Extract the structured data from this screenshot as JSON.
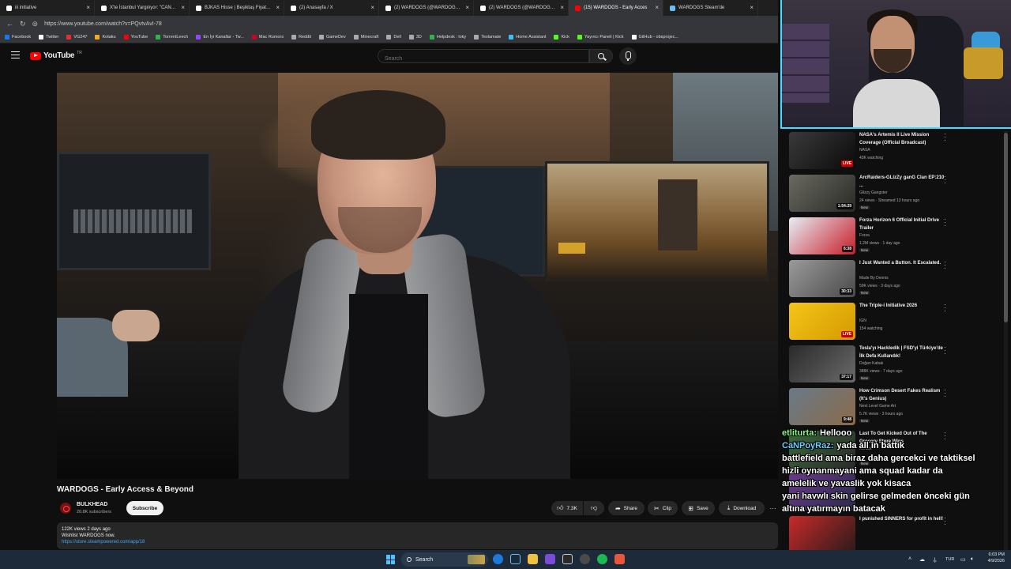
{
  "browser": {
    "tabs": [
      {
        "label": "iii initiative",
        "icon_color": "#ffffff",
        "active": false
      },
      {
        "label": "X'te İstanbul Yargılıyor: \"CANLI BL",
        "icon_color": "#ffffff",
        "active": false
      },
      {
        "label": "BJKAS Hisse | Beşiktaş Fiyatları - İn",
        "icon_color": "#ffffff",
        "active": false
      },
      {
        "label": "(2) Anasayfa / X",
        "icon_color": "#ffffff",
        "active": false
      },
      {
        "label": "(2) WARDOGS (@WARDOGS) / X",
        "icon_color": "#ffffff",
        "active": false
      },
      {
        "label": "(2) WARDOGS (@WARDOGS) / X",
        "icon_color": "#ffffff",
        "active": false
      },
      {
        "label": "(15) WARDOGS - Early Acces",
        "icon_color": "#ff0000",
        "active": true
      },
      {
        "label": "WARDOGS Steam'de",
        "icon_color": "#66c0f4",
        "active": false
      }
    ],
    "url": "https://www.youtube.com/watch?v=PQvtvAvI-78",
    "bookmarks": [
      {
        "label": "Facebook",
        "color": "#1877f2"
      },
      {
        "label": "Twitter",
        "color": "#ffffff"
      },
      {
        "label": "VG247",
        "color": "#e63030"
      },
      {
        "label": "Kotaku",
        "color": "#f5a623"
      },
      {
        "label": "YouTube",
        "color": "#ff0000"
      },
      {
        "label": "TorrentLeech",
        "color": "#2fb34a"
      },
      {
        "label": "En İyi Kanallar - Tw...",
        "color": "#9146ff"
      },
      {
        "label": "Mac Rumors",
        "color": "#d0021b"
      },
      {
        "label": "Reddit",
        "color": "#aaaaaa"
      },
      {
        "label": "GameDev",
        "color": "#aaaaaa"
      },
      {
        "label": "Minecraft",
        "color": "#aaaaaa"
      },
      {
        "label": "Dell",
        "color": "#aaaaaa"
      },
      {
        "label": "3D",
        "color": "#aaaaaa"
      },
      {
        "label": "Helpdesk : loky",
        "color": "#2fb34a"
      },
      {
        "label": "Teslamate",
        "color": "#aaaaaa"
      },
      {
        "label": "Home Assistant",
        "color": "#41bdf5"
      },
      {
        "label": "Kick",
        "color": "#53fc18"
      },
      {
        "label": "Yayıncı Paneli | Kick",
        "color": "#53fc18"
      },
      {
        "label": "GitHub - obsprojec...",
        "color": "#ffffff"
      }
    ]
  },
  "header": {
    "logo": "YouTube",
    "region": "TR",
    "search_placeholder": "Search"
  },
  "video": {
    "title": "WARDOGS - Early Access & Beyond",
    "channel": "BULKHEAD",
    "subscribers": "20.8K subscribers",
    "subscribe_label": "Subscribe",
    "likes": "7.3K",
    "share_label": "Share",
    "clip_label": "Clip",
    "save_label": "Save",
    "download_label": "Download",
    "more_label": "···",
    "views_line": "122K views  2 days ago",
    "description": "Wishlist WARDOGS now.",
    "link": "https://store.steampowered.com/app/18"
  },
  "recommendations": [
    {
      "title": "NASA's Artemis II Live Mission Coverage (Official Broadcast)",
      "channel": "NASA",
      "meta": "43K watching",
      "badge": "LIVE",
      "live": true,
      "new": "",
      "thumb": [
        "#3a3a3a",
        "#0a0a0a"
      ]
    },
    {
      "title": "ArcRaiders-GLizZy ganG Clan EP:210 ...",
      "channel": "Glizzy Gangster",
      "meta": "24 views · Streamed 13 hours ago",
      "badge": "1:54:29",
      "live": false,
      "new": "New",
      "thumb": [
        "#6a6a62",
        "#2a2a26"
      ]
    },
    {
      "title": "Forza Horizon 6 Official Initial Drive Trailer",
      "channel": "Forza",
      "meta": "1.2M views · 1 day ago",
      "badge": "6:38",
      "live": false,
      "new": "New",
      "thumb": [
        "#e8eef5",
        "#c41e2a"
      ]
    },
    {
      "title": "I Just Wanted a Button. It Escalated.",
      "channel": "Made By Dennis",
      "meta": "59K views · 3 days ago",
      "badge": "30:33",
      "live": false,
      "new": "New",
      "thumb": [
        "#9a9a9a",
        "#4a4a4a"
      ]
    },
    {
      "title": "The Triple-i Initiative 2026",
      "channel": "IGN",
      "meta": "154 watching",
      "badge": "LIVE",
      "live": true,
      "new": "",
      "thumb": [
        "#f5c518",
        "#d49a00"
      ]
    },
    {
      "title": "Tesla'yı Hackledik | FSD'yi Türkiye'de İlk Defa Kullandık!",
      "channel": "Doğan Kabak",
      "meta": "388K views · 7 days ago",
      "badge": "37:17",
      "live": false,
      "new": "New",
      "thumb": [
        "#2a2a2a",
        "#6a6a6a"
      ]
    },
    {
      "title": "How Crimson Desert Fakes Realism (It's Genius)",
      "channel": "Next Level Game Art",
      "meta": "5.7K views · 3 hours ago",
      "badge": "9:48",
      "live": false,
      "new": "New",
      "thumb": [
        "#6a7a88",
        "#8a6a4a"
      ]
    },
    {
      "title": "Last To Get Kicked Out of The Grocery Store Wins",
      "channel": "Airrack",
      "meta": "",
      "badge": "",
      "live": false,
      "new": "New",
      "thumb": [
        "#3a6a3a",
        "#2a2a2a"
      ]
    },
    {
      "title": "",
      "channel": "",
      "meta": "",
      "badge": "",
      "live": false,
      "new": "",
      "thumb": [
        "#6a3a8a",
        "#2a2a4a"
      ]
    },
    {
      "title": "I punished SINNERS for profit in hell!",
      "channel": "",
      "meta": "",
      "badge": "",
      "live": false,
      "new": "",
      "thumb": [
        "#c82a2a",
        "#2a1a1a"
      ]
    }
  ],
  "chat": [
    {
      "user": "etliturta:",
      "color": "#7cff7c",
      "message": "Hellooo"
    },
    {
      "user": "CaNPoyRaz:",
      "color": "#6ad0ff",
      "message": "yada all in battık"
    },
    {
      "user": "",
      "color": "#ffffff",
      "message": "battlefield ama biraz daha gercekci ve taktiksel hizli oynanmayani ama squad kadar da amelelik ve yavaslik yok kisaca"
    },
    {
      "user": "",
      "color": "#ffffff",
      "message": "yani havwlı skin gelirse gelmeden önceki gün altına yatırmayın batacak"
    }
  ],
  "taskbar": {
    "search_label": "Search",
    "lang": "TUR",
    "time": "6:03 PM",
    "date": "4/9/2026"
  }
}
